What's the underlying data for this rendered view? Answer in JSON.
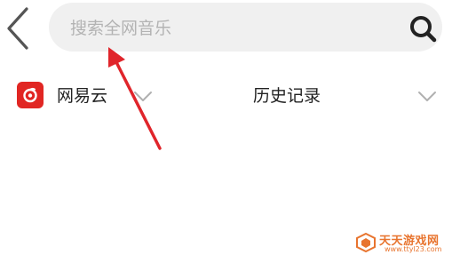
{
  "header": {
    "back_icon": "chevron-left-icon",
    "search": {
      "placeholder": "搜索全网音乐",
      "value": "",
      "icon": "search-icon"
    }
  },
  "source": {
    "label": "网易云",
    "logo": "netease-cloud-music-logo",
    "logo_color": "#e12623",
    "dropdown_icon": "chevron-down-icon"
  },
  "history": {
    "label": "历史记录",
    "dropdown_icon": "chevron-down-icon"
  },
  "annotation": {
    "arrow_color": "#e0252b",
    "points_to": "search-input"
  },
  "watermark": {
    "text": "天天游戏网",
    "url": "www.ttyl23.com",
    "color": "#e8742e"
  }
}
